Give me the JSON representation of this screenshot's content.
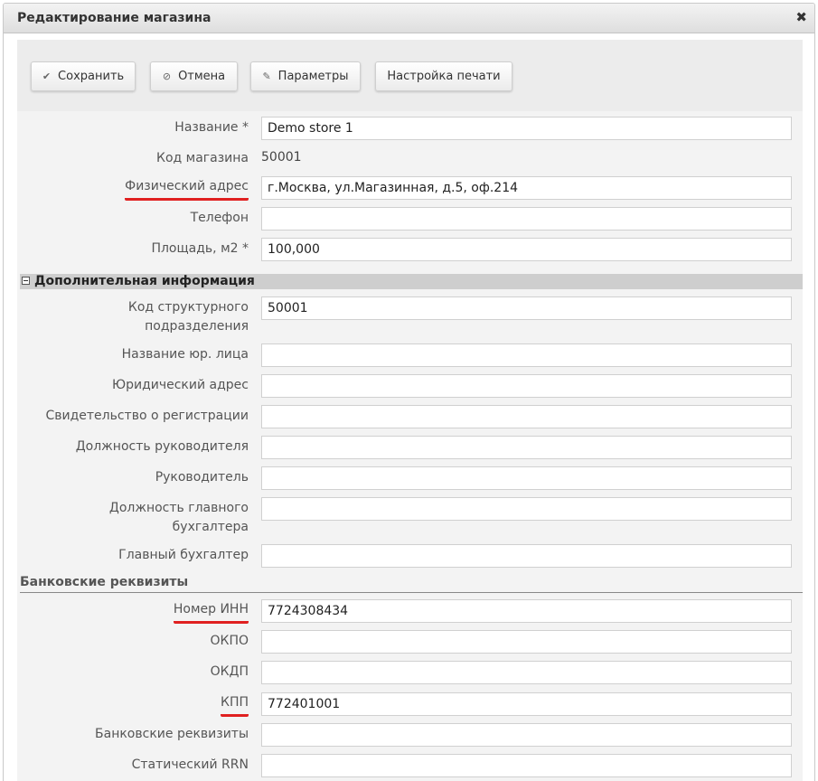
{
  "dialog": {
    "title": "Редактирование магазина",
    "close_glyph": "✖"
  },
  "toolbar": {
    "save_label": "Сохранить",
    "save_icon": "✔",
    "cancel_label": "Отмена",
    "cancel_icon": "⊘",
    "params_label": "Параметры",
    "params_icon": "✎",
    "print_label": "Настройка печати"
  },
  "main": {
    "name": {
      "label": "Название *",
      "value": "Demo store 1"
    },
    "code": {
      "label": "Код магазина",
      "value": "50001"
    },
    "address": {
      "label": "Физический адрес",
      "value": "г.Москва, ул.Магазинная, д.5, оф.214"
    },
    "phone": {
      "label": "Телефон",
      "value": ""
    },
    "area": {
      "label": "Площадь, м2 *",
      "value": "100,000"
    }
  },
  "extra": {
    "title": "Дополнительная информация",
    "unit_code": {
      "label": "Код структурного подразделения",
      "value": "50001"
    },
    "legal_name": {
      "label": "Название юр. лица",
      "value": ""
    },
    "legal_address": {
      "label": "Юридический адрес",
      "value": ""
    },
    "registration": {
      "label": "Свидетельство о регистрации",
      "value": ""
    },
    "director_position": {
      "label": "Должность руководителя",
      "value": ""
    },
    "director": {
      "label": "Руководитель",
      "value": ""
    },
    "accountant_position": {
      "label": "Должность главного бухгалтера",
      "value": ""
    },
    "accountant": {
      "label": "Главный бухгалтер",
      "value": ""
    }
  },
  "bank": {
    "title": "Банковские реквизиты",
    "inn": {
      "label": "Номер ИНН",
      "value": "7724308434"
    },
    "okpo": {
      "label": "ОКПО",
      "value": ""
    },
    "okdp": {
      "label": "ОКДП",
      "value": ""
    },
    "kpp": {
      "label": "КПП",
      "value": "772401001"
    },
    "details": {
      "label": "Банковские реквизиты",
      "value": ""
    },
    "rrn": {
      "label": "Статический RRN",
      "value": ""
    }
  },
  "colors": {
    "highlight": "#e02020",
    "section_bg": "#cecece",
    "form_bg": "#f3f3f3"
  }
}
